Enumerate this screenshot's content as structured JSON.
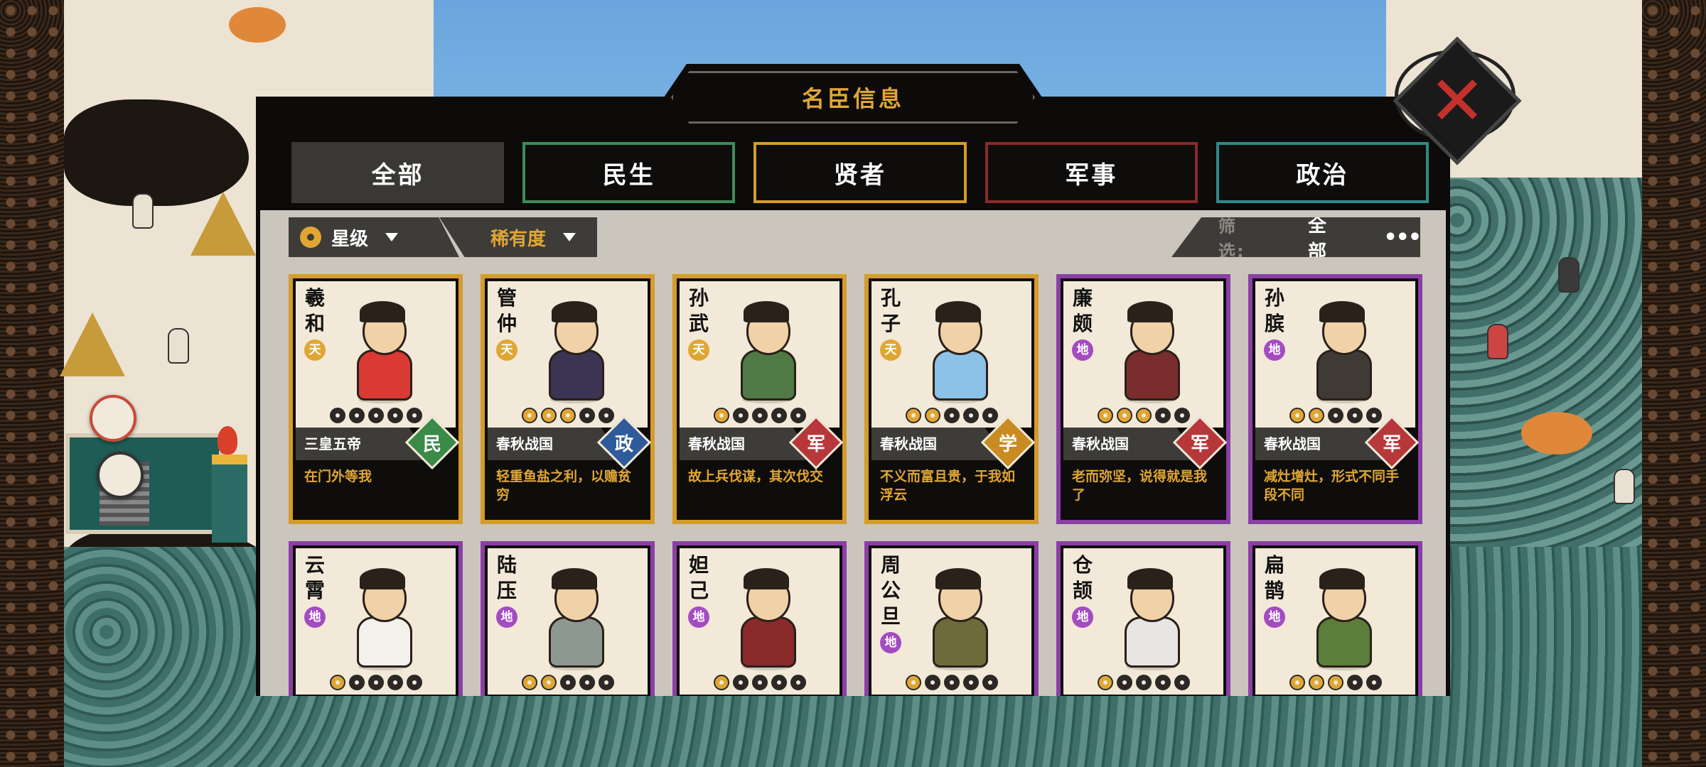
{
  "window": {
    "title": "名臣信息",
    "close_icon": "close-x-icon"
  },
  "tabs": [
    {
      "label": "全部",
      "active": true
    },
    {
      "label": "民生",
      "border": "#3d8c5a"
    },
    {
      "label": "贤者",
      "border": "#d59b2b"
    },
    {
      "label": "军事",
      "border": "#8c2a2a"
    },
    {
      "label": "政治",
      "border": "#2e8a86"
    }
  ],
  "filter": {
    "sort_star": "星级",
    "sort_rarity": "稀有度",
    "filter_label": "筛选:",
    "filter_value": "全部",
    "more": "•••"
  },
  "colors": {
    "gold": "#e0a634",
    "purple": "#8b3fa6",
    "min": "#3a8a48",
    "zheng": "#2f5b9a",
    "jun": "#b8373a",
    "xue": "#c98b22"
  },
  "cards": [
    {
      "name": "羲和",
      "tier": "天",
      "rarity": "gold",
      "stars": 0,
      "era": "三皇五帝",
      "category": "民",
      "category_color": "#3a8a48",
      "quote": "在门外等我"
    },
    {
      "name": "管仲",
      "tier": "天",
      "rarity": "gold",
      "stars": 3,
      "era": "春秋战国",
      "category": "政",
      "category_color": "#2f5b9a",
      "quote": "轻重鱼盐之利，以赡贫穷"
    },
    {
      "name": "孙武",
      "tier": "天",
      "rarity": "gold",
      "stars": 1,
      "era": "春秋战国",
      "category": "军",
      "category_color": "#b8373a",
      "quote": "故上兵伐谋，其次伐交"
    },
    {
      "name": "孔子",
      "tier": "天",
      "rarity": "gold",
      "stars": 2,
      "era": "春秋战国",
      "category": "学",
      "category_color": "#c98b22",
      "quote": "不义而富且贵，于我如浮云"
    },
    {
      "name": "廉颇",
      "tier": "地",
      "rarity": "purple",
      "stars": 3,
      "era": "春秋战国",
      "category": "军",
      "category_color": "#b8373a",
      "quote": "老而弥坚，说得就是我了"
    },
    {
      "name": "孙膑",
      "tier": "地",
      "rarity": "purple",
      "stars": 2,
      "era": "春秋战国",
      "category": "军",
      "category_color": "#b8373a",
      "quote": "减灶增灶，形式不同手段不同"
    },
    {
      "name": "云霄",
      "tier": "地",
      "rarity": "purple",
      "stars": 1
    },
    {
      "name": "陆压",
      "tier": "地",
      "rarity": "purple",
      "stars": 2
    },
    {
      "name": "妲己",
      "tier": "地",
      "rarity": "purple",
      "stars": 1
    },
    {
      "name": "周公旦",
      "tier": "地",
      "rarity": "purple",
      "stars": 1
    },
    {
      "name": "仓颉",
      "tier": "地",
      "rarity": "purple",
      "stars": 1
    },
    {
      "name": "扁鹊",
      "tier": "地",
      "rarity": "purple",
      "stars": 3
    }
  ]
}
